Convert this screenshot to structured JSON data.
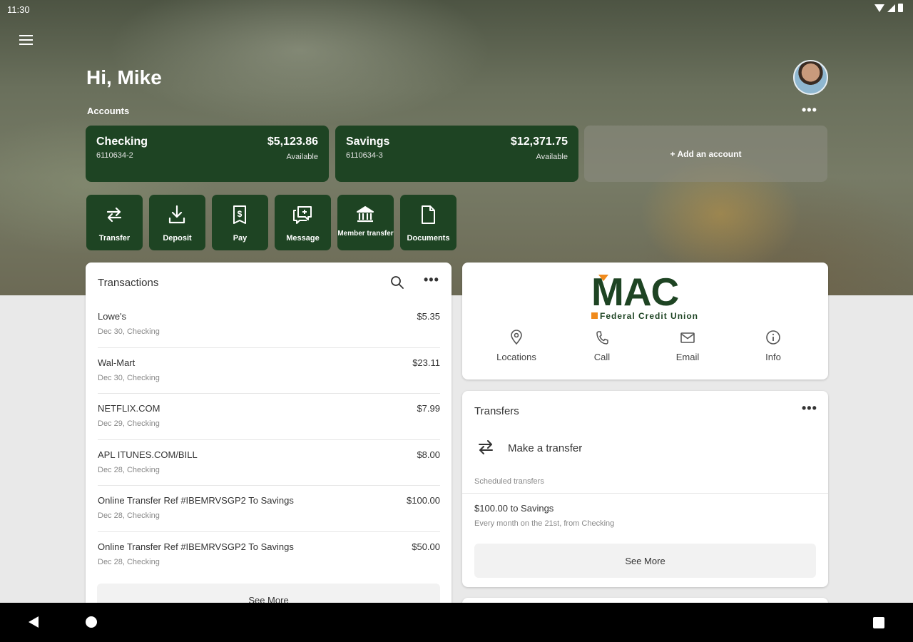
{
  "status_bar": {
    "time": "11:30"
  },
  "header": {
    "greeting": "Hi, Mike",
    "accounts_label": "Accounts",
    "more_label": "•••"
  },
  "accounts": [
    {
      "name": "Checking",
      "number": "6110634-2",
      "balance": "$5,123.86",
      "available_label": "Available"
    },
    {
      "name": "Savings",
      "number": "6110634-3",
      "balance": "$12,371.75",
      "available_label": "Available"
    }
  ],
  "add_account_label": "+ Add an account",
  "actions": [
    {
      "label": "Transfer",
      "icon": "transfer-icon"
    },
    {
      "label": "Deposit",
      "icon": "deposit-icon"
    },
    {
      "label": "Pay",
      "icon": "pay-icon"
    },
    {
      "label": "Message",
      "icon": "message-icon"
    },
    {
      "label": "Member transfer",
      "icon": "bank-icon"
    },
    {
      "label": "Documents",
      "icon": "document-icon"
    }
  ],
  "transactions": {
    "title": "Transactions",
    "more_label": "•••",
    "items": [
      {
        "name": "Lowe's",
        "detail": "Dec 30, Checking",
        "amount": "$5.35"
      },
      {
        "name": "Wal-Mart",
        "detail": "Dec 30, Checking",
        "amount": "$23.11"
      },
      {
        "name": "NETFLIX.COM",
        "detail": "Dec 29, Checking",
        "amount": "$7.99"
      },
      {
        "name": "APL ITUNES.COM/BILL",
        "detail": "Dec 28, Checking",
        "amount": "$8.00"
      },
      {
        "name": "Online Transfer Ref #IBEMRVSGP2 To Savings",
        "detail": "Dec 28, Checking",
        "amount": "$100.00"
      },
      {
        "name": "Online Transfer Ref #IBEMRVSGP2 To Savings",
        "detail": "Dec 28, Checking",
        "amount": "$50.00"
      }
    ],
    "see_more": "See More"
  },
  "institution": {
    "logo_text": "MAC",
    "logo_subtitle": "Federal Credit Union",
    "brand_color": "#1e4423",
    "accent_color": "#f08a1c",
    "contacts": [
      {
        "label": "Locations",
        "icon": "location-pin-icon"
      },
      {
        "label": "Call",
        "icon": "phone-icon"
      },
      {
        "label": "Email",
        "icon": "email-icon"
      },
      {
        "label": "Info",
        "icon": "info-icon"
      }
    ]
  },
  "transfers": {
    "title": "Transfers",
    "more_label": "•••",
    "make_transfer": "Make a transfer",
    "scheduled_label": "Scheduled transfers",
    "scheduled": [
      {
        "title": "$100.00 to Savings",
        "detail": "Every month on the 21st, from Checking"
      }
    ],
    "see_more": "See More"
  }
}
